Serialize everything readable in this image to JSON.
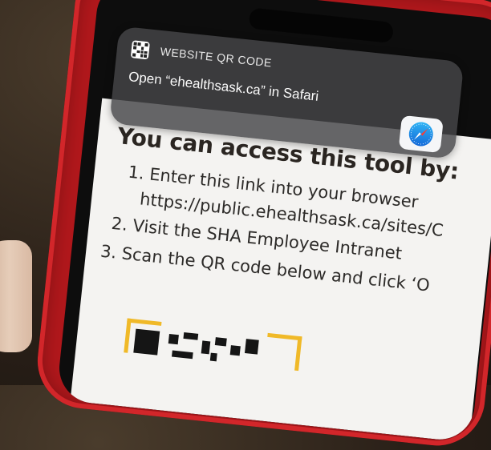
{
  "notification": {
    "app_name": "WEBSITE QR CODE",
    "message": "Open “ehealthsask.ca” in Safari",
    "action_icon": "safari-icon",
    "app_icon": "qr-code-icon"
  },
  "document": {
    "heading": "You can access this tool by:",
    "lines": [
      "1. Enter this link into your browser",
      "https://public.ehealthsask.ca/sites/C",
      "2. Visit the SHA Employee Intranet",
      "3. Scan the QR code below and click ‘O"
    ]
  },
  "colors": {
    "case": "#b3181c",
    "banner": "#464648",
    "qr_frame": "#f0b928",
    "safari_blue": "#1e88e5"
  }
}
